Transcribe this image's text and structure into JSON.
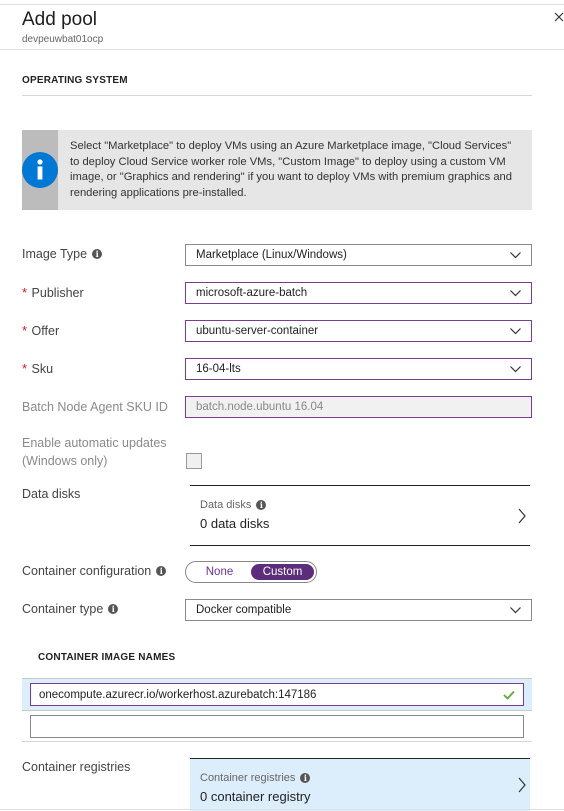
{
  "header": {
    "title": "Add pool",
    "subtitle": "devpeuwbat01ocp",
    "close_icon": "close-icon"
  },
  "operating_system": {
    "section_title": "OPERATING SYSTEM",
    "info_box": {
      "icon": "info-circle-icon",
      "text": "Select \"Marketplace\" to deploy VMs using an Azure Marketplace image, \"Cloud Services\" to deploy Cloud Service worker role VMs, \"Custom Image\" to deploy using a custom VM image, or \"Graphics and rendering\" if you want to deploy VMs with premium graphics and rendering applications pre-installed."
    },
    "fields": {
      "image_type": {
        "label": "Image Type",
        "value": "Marketplace (Linux/Windows)",
        "has_info": true
      },
      "publisher": {
        "label": "Publisher",
        "value": "microsoft-azure-batch",
        "required": true
      },
      "offer": {
        "label": "Offer",
        "value": "ubuntu-server-container",
        "required": true
      },
      "sku": {
        "label": "Sku",
        "value": "16-04-lts",
        "required": true
      },
      "node_agent_sku": {
        "label": "Batch Node Agent SKU ID",
        "value": "batch.node.ubuntu 16.04",
        "disabled": true
      },
      "auto_updates": {
        "label_line1": "Enable automatic updates",
        "label_line2": "(Windows only)",
        "checked": false,
        "disabled": true
      }
    },
    "required_marker": "*",
    "info_glyph": "i"
  },
  "data_disks": {
    "label": "Data disks",
    "link_label": "Data disks",
    "link_value": "0 data disks"
  },
  "container": {
    "configuration_label": "Container configuration",
    "configuration_options": [
      "None",
      "Custom"
    ],
    "configuration_selected": "Custom",
    "type_label": "Container type",
    "type_value": "Docker compatible",
    "image_names_title": "CONTAINER IMAGE NAMES",
    "image_names": [
      {
        "value": "onecompute.azurecr.io/workerhost.azurebatch:147186",
        "valid": true
      },
      {
        "value": "",
        "valid": false
      }
    ],
    "registries_label": "Container registries",
    "registries_link_label": "Container registries",
    "registries_link_value": "0 container registry"
  },
  "colors": {
    "accent_purple": "#5c2d7a",
    "valid_border": "#7a3b92",
    "required_red": "#e81123",
    "info_blue": "#0078d4",
    "highlight_blue": "#dcedfb",
    "check_green": "#5ea83a"
  }
}
